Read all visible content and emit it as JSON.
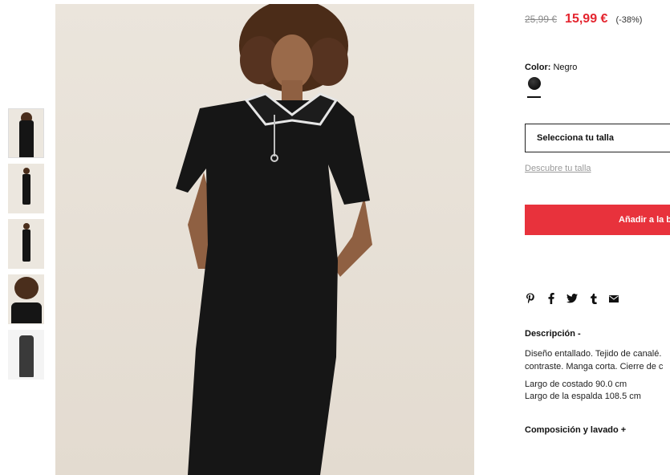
{
  "product": {
    "price_old": "25,99 €",
    "price_new": "15,99 €",
    "discount": "(-38%)",
    "color_label": "Color:",
    "color_value": "Negro",
    "size_placeholder": "Selecciona tu talla",
    "size_link": "Descubre tu talla",
    "add_button": "Añadir a la b"
  },
  "description": {
    "title": "Descripción -",
    "line1": "Diseño entallado. Tejido de canalé.",
    "line2": "contraste. Manga corta. Cierre de c",
    "measure1": "Largo de costado 90.0 cm",
    "measure2": "Largo de la espalda 108.5 cm"
  },
  "composition_title": "Composición y lavado +",
  "share_icons": [
    "pinterest-icon",
    "facebook-icon",
    "twitter-icon",
    "tumblr-icon",
    "mail-icon"
  ],
  "colors": {
    "price_sale": "#e4252f",
    "button_bg": "#e8323c",
    "swatch": "#111111"
  }
}
